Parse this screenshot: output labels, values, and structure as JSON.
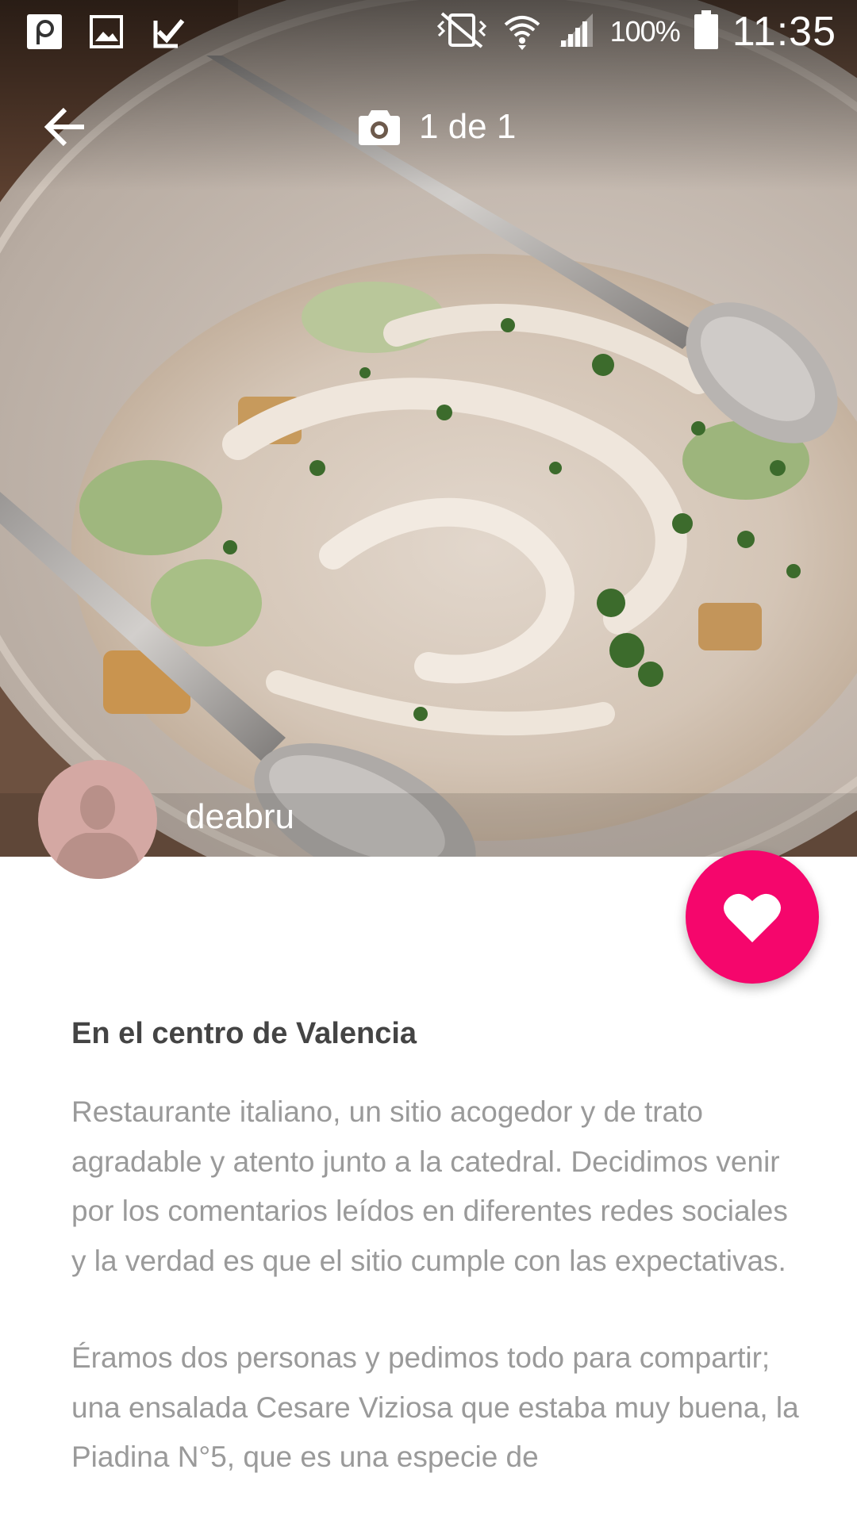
{
  "status_bar": {
    "battery_percent": "100%",
    "time": "11:35",
    "left_icons": [
      "parking-app-icon",
      "gallery-icon",
      "tasks-check-icon"
    ],
    "right_icons": [
      "vibrate-silent-icon",
      "wifi-icon",
      "signal-icon",
      "battery-icon"
    ]
  },
  "app_bar": {
    "back_icon": "arrow-back-icon",
    "camera_icon": "camera-icon",
    "photo_counter": "1 de 1"
  },
  "author": {
    "username": "deabru",
    "avatar_icon": "person-silhouette-icon"
  },
  "like_button": {
    "icon": "heart-icon",
    "color": "#f5066c"
  },
  "review": {
    "title": "En el centro de Valencia",
    "paragraphs": [
      "Restaurante italiano, un sitio acogedor y de trato agradable y atento junto a la catedral. Decidimos venir por los comentarios leídos en diferentes redes sociales y la verdad es que el sitio cumple con las expectativas.",
      "Éramos dos personas y pedimos todo para compartir; una ensalada Cesare Viziosa que estaba muy buena, la Piadina N°5, que es una especie de"
    ]
  }
}
